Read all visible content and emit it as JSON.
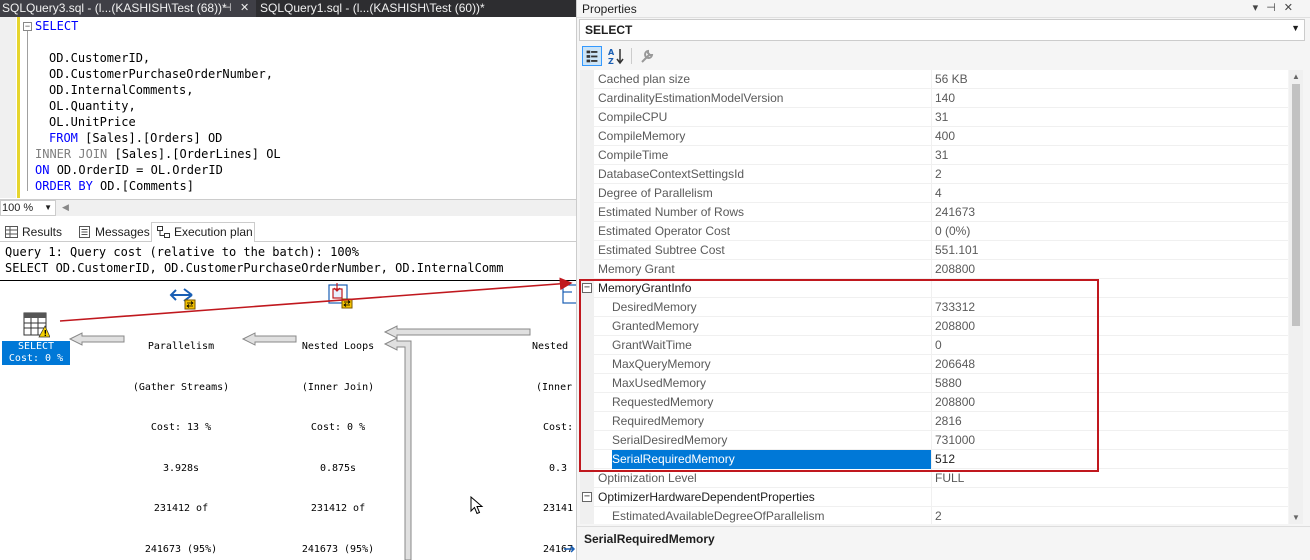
{
  "tabs": [
    {
      "label": "SQLQuery3.sql - (l...(KASHISH\\Test (68))*",
      "active": true
    },
    {
      "label": "SQLQuery1.sql - (l...(KASHISH\\Test (60))*",
      "active": false
    }
  ],
  "editor": {
    "lines": [
      [
        "SELECT"
      ],
      [
        ""
      ],
      [
        "OD.CustomerID,"
      ],
      [
        "OD.CustomerPurchaseOrderNumber,"
      ],
      [
        "OD.InternalComments,"
      ],
      [
        "OL.Quantity,"
      ],
      [
        "OL.UnitPrice"
      ],
      [
        "FROM",
        "[Sales].[Orders] OD"
      ],
      [
        "INNER JOIN",
        "[Sales].[OrderLines] OL"
      ],
      [
        "ON",
        "OD.OrderID = OL.OrderID"
      ],
      [
        "ORDER BY",
        "OD.[Comments]"
      ]
    ],
    "zoom": "100 %"
  },
  "results_tabs": {
    "results": "Results",
    "messages": "Messages",
    "plan": "Execution plan"
  },
  "plan": {
    "query_line": "Query 1: Query cost (relative to the batch): 100%",
    "statement_line": "SELECT OD.CustomerID, OD.CustomerPurchaseOrderNumber, OD.InternalComm",
    "select_op": {
      "name": "SELECT",
      "cost": "Cost: 0 %"
    },
    "parallelism": {
      "name": "Parallelism",
      "sub": "(Gather Streams)",
      "cost": "Cost: 13 %",
      "time": "3.928s",
      "rows": "231412 of",
      "est": "241673 (95%)"
    },
    "nested1": {
      "name": "Nested Loops",
      "sub": "(Inner Join)",
      "cost": "Cost: 0 %",
      "time": "0.875s",
      "rows": "231412 of",
      "est": "241673 (95%)"
    },
    "nested2": {
      "name": "Nested",
      "sub": "(Inner",
      "cost": "Cost:",
      "time": "0.3",
      "rows": "23141",
      "est": "24167"
    }
  },
  "properties": {
    "title": "Properties",
    "object": "SELECT",
    "rows": [
      {
        "name": "Cached plan size",
        "value": "56 KB"
      },
      {
        "name": "CardinalityEstimationModelVersion",
        "value": "140"
      },
      {
        "name": "CompileCPU",
        "value": "31"
      },
      {
        "name": "CompileMemory",
        "value": "400"
      },
      {
        "name": "CompileTime",
        "value": "31"
      },
      {
        "name": "DatabaseContextSettingsId",
        "value": "2"
      },
      {
        "name": "Degree of Parallelism",
        "value": "4"
      },
      {
        "name": "Estimated Number of Rows",
        "value": "241673"
      },
      {
        "name": "Estimated Operator Cost",
        "value": "0 (0%)"
      },
      {
        "name": "Estimated Subtree Cost",
        "value": "551.101"
      },
      {
        "name": "Memory Grant",
        "value": "208800"
      },
      {
        "name": "MemoryGrantInfo",
        "value": "",
        "category": true
      },
      {
        "name": "DesiredMemory",
        "value": "733312",
        "sub": true
      },
      {
        "name": "GrantedMemory",
        "value": "208800",
        "sub": true
      },
      {
        "name": "GrantWaitTime",
        "value": "0",
        "sub": true
      },
      {
        "name": "MaxQueryMemory",
        "value": "206648",
        "sub": true
      },
      {
        "name": "MaxUsedMemory",
        "value": "5880",
        "sub": true
      },
      {
        "name": "RequestedMemory",
        "value": "208800",
        "sub": true
      },
      {
        "name": "RequiredMemory",
        "value": "2816",
        "sub": true
      },
      {
        "name": "SerialDesiredMemory",
        "value": "731000",
        "sub": true
      },
      {
        "name": "SerialRequiredMemory",
        "value": "512",
        "sub": true,
        "selected": true
      },
      {
        "name": "Optimization Level",
        "value": "FULL"
      },
      {
        "name": "OptimizerHardwareDependentProperties",
        "value": "",
        "category": true
      },
      {
        "name": "EstimatedAvailableDegreeOfParallelism",
        "value": "2",
        "sub": true
      }
    ],
    "description": "SerialRequiredMemory"
  },
  "colors": {
    "selection": "#0078d7",
    "highlight_box": "#c0181e",
    "keyword": "#0000ff"
  }
}
